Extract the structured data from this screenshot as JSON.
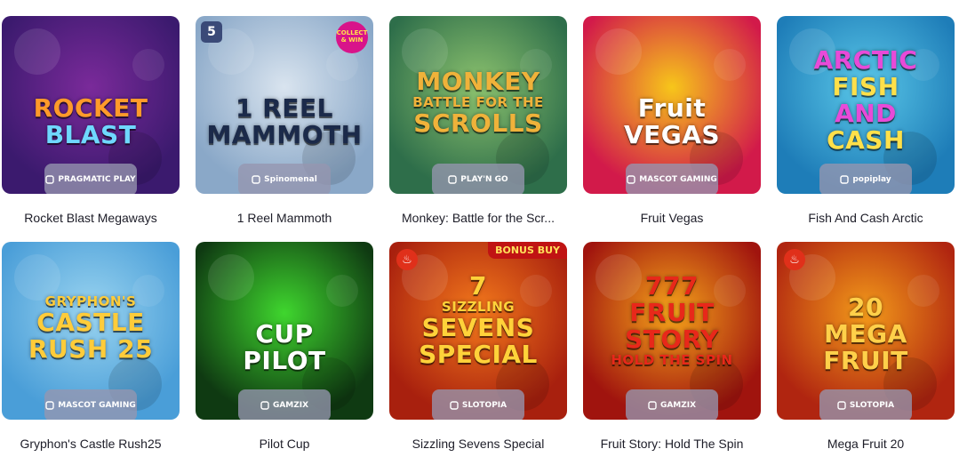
{
  "games": [
    {
      "title": "Rocket Blast Megaways",
      "logo": [
        "ROCKET",
        "BLAST"
      ],
      "provider": "PRAGMATIC PLAY",
      "provider_icon": "pragmatic-icon",
      "colors": {
        "bg1": "#3b1a6e",
        "bg2": "#7a2a9a",
        "logo": "#ff9a2a",
        "logo2": "#6fd8ff"
      }
    },
    {
      "title": "1 Reel Mammoth",
      "logo": [
        "1 REEL",
        "MAMMOTH"
      ],
      "provider": "Spinomenal",
      "provider_icon": "spinomenal-icon",
      "corner_text": "COLLECT & WIN",
      "corner_badge": "5",
      "colors": {
        "bg1": "#8aa8c8",
        "bg2": "#d9e4ef",
        "logo": "#1b2a4a"
      }
    },
    {
      "title": "Monkey: Battle for the Scr...",
      "logo": [
        "MONKEY",
        "BATTLE FOR THE",
        "SCROLLS"
      ],
      "provider": "PLAY'N GO",
      "provider_icon": "playngo-icon",
      "colors": {
        "bg1": "#2e6e4a",
        "bg2": "#8cc26e",
        "logo": "#f0b23a"
      }
    },
    {
      "title": "Fruit Vegas",
      "logo": [
        "Fruit",
        "VEGAS"
      ],
      "provider": "MASCOT GAMING",
      "provider_icon": "mascot-icon",
      "colors": {
        "bg1": "#d21a4a",
        "bg2": "#f7c61a",
        "logo": "#ffffff"
      }
    },
    {
      "title": "Fish And Cash Arctic",
      "logo": [
        "ARCTIC",
        "FISH",
        "AND",
        "CASH"
      ],
      "provider": "popiplay",
      "provider_icon": "popiplay-icon",
      "colors": {
        "bg1": "#1e7db8",
        "bg2": "#5ac7e8",
        "logo": "#e84ad8",
        "logo2": "#ffe04a"
      }
    },
    {
      "title": "Gryphon's Castle Rush25",
      "logo": [
        "GRYPHON'S",
        "CASTLE",
        "RUSH 25"
      ],
      "provider": "MASCOT GAMING",
      "provider_icon": "mascot-icon",
      "colors": {
        "bg1": "#4a9ed8",
        "bg2": "#9ad4f0",
        "logo": "#ffcc3a"
      }
    },
    {
      "title": "Pilot Cup",
      "logo": [
        "CUP",
        "PILOT"
      ],
      "provider": "GAMZIX",
      "provider_icon": "gamzix-icon",
      "colors": {
        "bg1": "#0f3a12",
        "bg2": "#3fd62e",
        "logo": "#ffffff"
      }
    },
    {
      "title": "Sizzling Sevens Special",
      "logo": [
        "7",
        "SIZZLING",
        "SEVENS",
        "SPECIAL"
      ],
      "provider": "SLOTOPIA",
      "provider_icon": "slotopia-icon",
      "badge": "BONUS BUY",
      "colors": {
        "bg1": "#a8200e",
        "bg2": "#f47a1c",
        "logo": "#ffd23a"
      }
    },
    {
      "title": "Fruit Story: Hold The Spin",
      "logo": [
        "777",
        "FRUIT",
        "STORY",
        "HOLD THE SPIN"
      ],
      "provider": "GAMZIX",
      "provider_icon": "gamzix-icon",
      "colors": {
        "bg1": "#a0140e",
        "bg2": "#f5a41a",
        "logo": "#e8281a"
      }
    },
    {
      "title": "Mega Fruit 20",
      "logo": [
        "20",
        "MEGA",
        "FRUIT"
      ],
      "provider": "SLOTOPIA",
      "provider_icon": "slotopia-icon",
      "colors": {
        "bg1": "#b02510",
        "bg2": "#f39a1a",
        "logo": "#ffd04a"
      }
    }
  ]
}
